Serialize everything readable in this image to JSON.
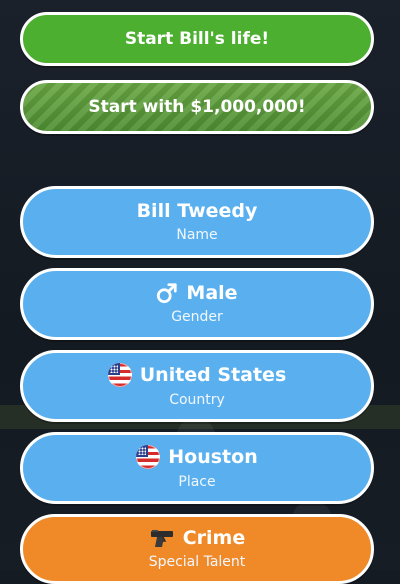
{
  "actions": {
    "start_life_label": "Start Bill's life!",
    "start_rich_label": "Start with $1,000,000!"
  },
  "profile": {
    "name": {
      "value": "Bill Tweedy",
      "label": "Name"
    },
    "gender": {
      "value": "Male",
      "label": "Gender",
      "icon": "male-icon"
    },
    "country": {
      "value": "United States",
      "label": "Country",
      "icon": "us-flag-icon"
    },
    "place": {
      "value": "Houston",
      "label": "Place",
      "icon": "us-flag-icon"
    },
    "talent": {
      "value": "Crime",
      "label": "Special Talent",
      "icon": "pistol-icon"
    }
  },
  "colors": {
    "green": "#4caf2f",
    "blue": "#5ab0ee",
    "orange": "#f08a28",
    "background": "#151b23"
  }
}
